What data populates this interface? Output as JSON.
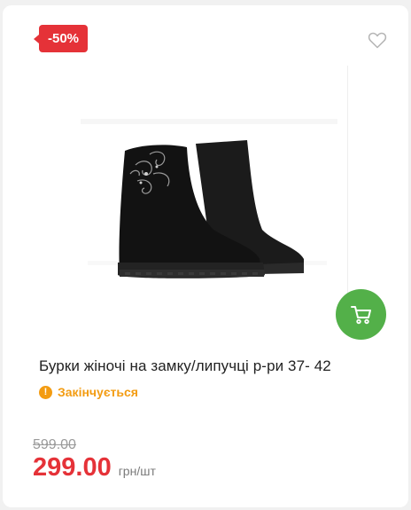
{
  "product": {
    "discount_badge": "-50%",
    "title": "Бурки жіночі на замку/липучці р-ри 37- 42",
    "status": "Закінчується",
    "old_price": "599.00",
    "price": "299.00",
    "price_unit": "грн/шт"
  },
  "colors": {
    "badge": "#e53238",
    "cart_button": "#53b049",
    "status": "#f39c12",
    "price": "#e53238"
  },
  "icons": {
    "favorite": "heart-outline-icon",
    "cart": "shopping-cart-icon",
    "status": "exclamation-circle-icon"
  }
}
